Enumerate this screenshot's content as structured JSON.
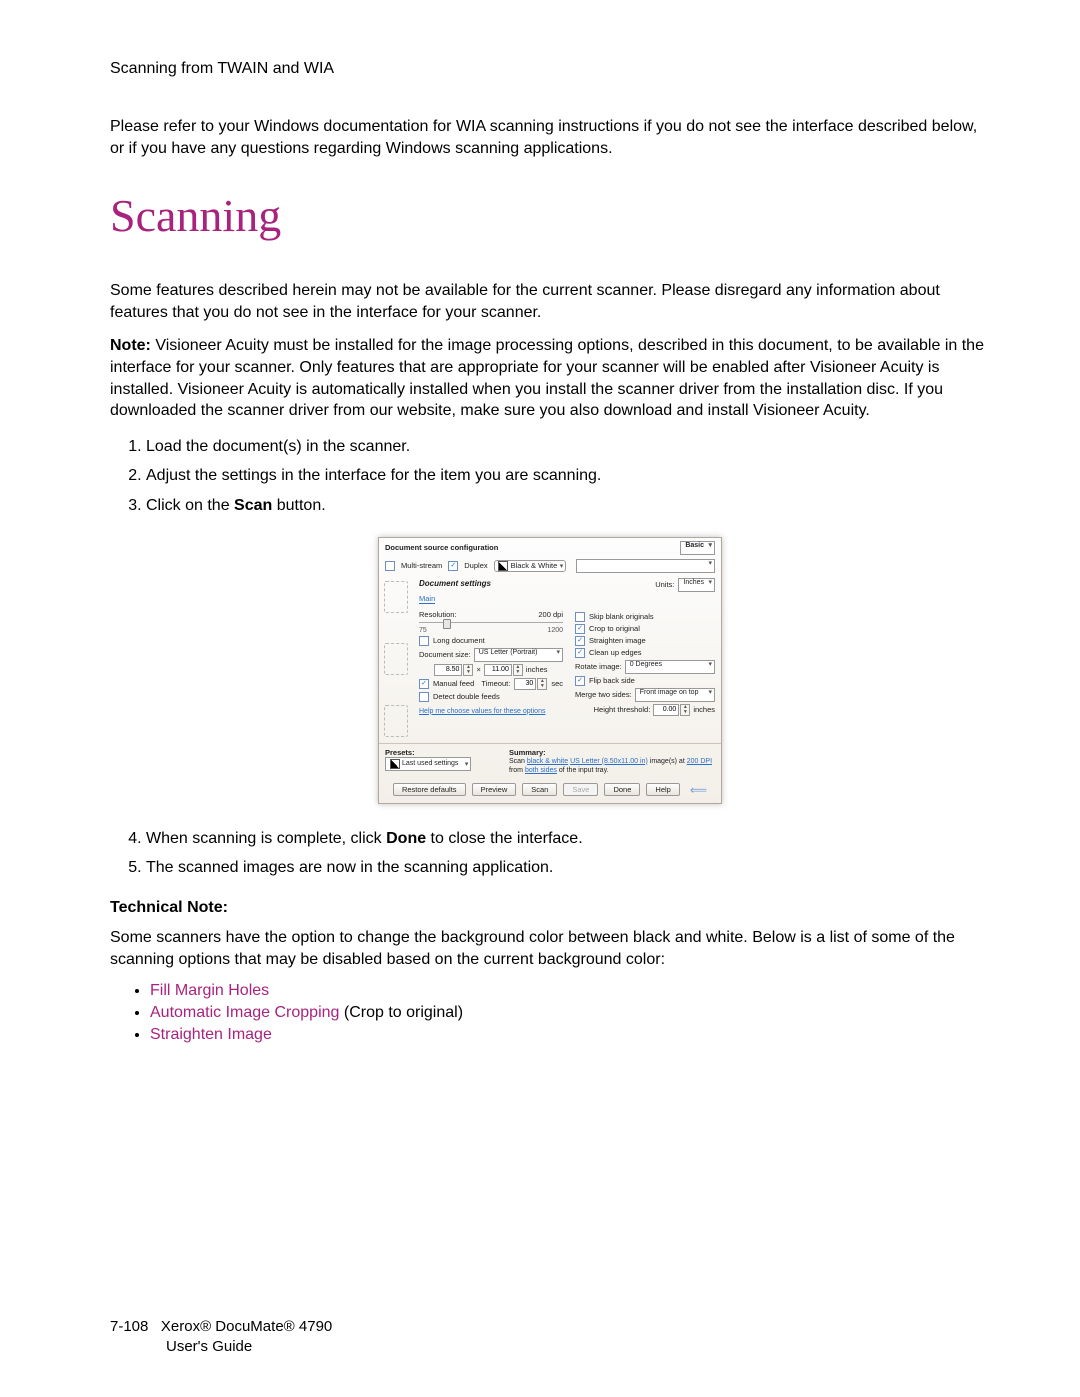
{
  "header": "Scanning from TWAIN and WIA",
  "intro": "Please refer to your Windows documentation for WIA scanning instructions if you do not see the interface described below, or if you have any questions regarding Windows scanning applications.",
  "h1": "Scanning",
  "p1": "Some features described herein may not be available for the current scanner. Please disregard any information about features that you do not see in the interface for your scanner.",
  "note_label": "Note:",
  "note_body": " Visioneer Acuity must be installed for the image processing options, described in this document, to be available in the interface for your scanner. Only features that are appropriate for your scanner will be enabled after Visioneer Acuity is installed. Visioneer Acuity is automatically installed when you install the scanner driver from the installation disc. If you downloaded the scanner driver from our website, make sure you also download and install Visioneer Acuity.",
  "steps_a": [
    "Load the document(s) in the scanner.",
    "Adjust the settings in the interface for the item you are scanning."
  ],
  "step3_pre": "Click on the ",
  "step3_bold": "Scan",
  "step3_post": " button.",
  "step4_pre": "When scanning is complete, click ",
  "step4_bold": "Done",
  "step4_post": " to close the interface.",
  "step5": "The scanned images are now in the scanning application.",
  "technical_note": "Technical Note:",
  "tn_para": "Some scanners have the option to change the background color between black and white.  Below is a list of some of the scanning options that may be disabled based on the current background color:",
  "bullets": {
    "b1": "Fill Margin Holes",
    "b2a": "Automatic Image Cropping",
    "b2b": " (Crop to original)",
    "b3": "Straighten Image"
  },
  "footer": {
    "page": "7-108",
    "l1": "Xerox® DocuMate® 4790",
    "l2": "User's Guide"
  },
  "dlg": {
    "title": "Document source configuration",
    "basic": "Basic",
    "multistream": "Multi-stream",
    "duplex": "Duplex",
    "mode": "Black & White",
    "doc_settings": "Document settings",
    "units_label": "Units:",
    "units_value": "Inches",
    "tab_main": "Main",
    "resolution": "Resolution:",
    "res_val": "200 dpi",
    "res_min": "75",
    "res_max": "1200",
    "long_doc": "Long document",
    "doc_size": "Document size:",
    "doc_size_val": "US Letter (Portrait)",
    "ds_w": "8.50",
    "ds_x": "×",
    "ds_h": "11.00",
    "ds_unit": "inches",
    "manual": "Manual feed",
    "timeout": "Timeout:",
    "timeout_val": "30",
    "timeout_unit": "sec",
    "detect_df": "Detect double feeds",
    "help_link": "Help me choose values for these options",
    "skip_blank": "Skip blank originals",
    "crop": "Crop to original",
    "straighten": "Straighten image",
    "cleanup": "Clean up edges",
    "rotate": "Rotate image:",
    "rotate_val": "0 Degrees",
    "flip": "Flip back side",
    "merge": "Merge two sides:",
    "merge_val": "Front image on top",
    "ht_label": "Height threshold:",
    "ht_val": "0.00",
    "ht_unit": "inches",
    "presets_label": "Presets:",
    "preset_val": "Last used settings",
    "summary_label": "Summary:",
    "sum_pre": "Scan ",
    "sum_bw": "black & white",
    "sum_mid1": " ",
    "sum_size": "US Letter (8.50x11.00 in)",
    "sum_mid2": " image(s) at ",
    "sum_dpi": "200 DPI",
    "sum_mid3": " from ",
    "sum_sides": "both sides",
    "sum_end": " of the input tray.",
    "btn_restore": "Restore defaults",
    "btn_preview": "Preview",
    "btn_scan": "Scan",
    "btn_save": "Save",
    "btn_done": "Done",
    "btn_help": "Help"
  }
}
